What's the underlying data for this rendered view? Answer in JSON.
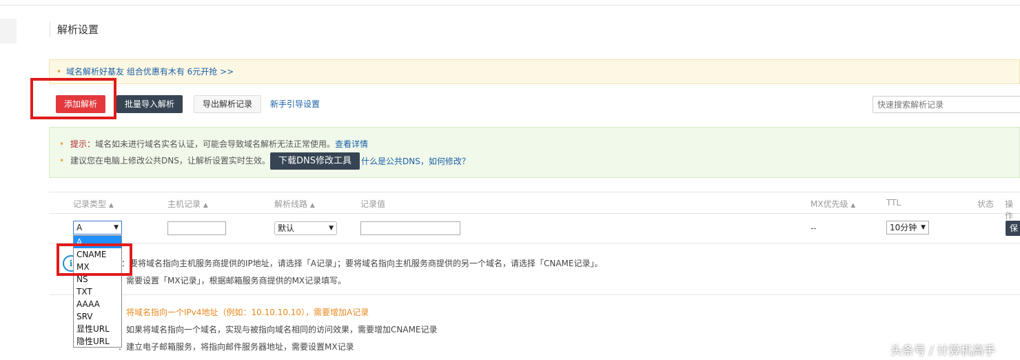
{
  "page_title": "解析设置",
  "promo": {
    "text": "域名解析好基友 组合优惠有木有 6元开抢 >>"
  },
  "toolbar": {
    "add": "添加解析",
    "batch_import": "批量导入解析",
    "export": "导出解析记录",
    "guide": "新手引导设置",
    "search_placeholder": "快速搜索解析记录"
  },
  "tips": {
    "label": "提示：",
    "line1": "域名如未进行域名实名认证，可能会导致域名解析无法正常使用。",
    "line1_link": "查看详情",
    "line2": "建议您在电脑上修改公共DNS，让解析设置实时生效。",
    "download_btn": "下载DNS修改工具",
    "line2_link": "什么是公共DNS，如何修改？"
  },
  "table": {
    "headers": {
      "type": "记录类型",
      "host": "主机记录",
      "line": "解析线路",
      "value": "记录值",
      "mx": "MX优先级",
      "ttl": "TTL",
      "status": "状态",
      "op": "操作"
    },
    "row": {
      "type": "A",
      "line": "默认",
      "mx": "--",
      "ttl": "10分钟",
      "save": "保"
    }
  },
  "type_options": [
    "A",
    "CNAME",
    "MX",
    "NS",
    "TXT",
    "AAAA",
    "SRV",
    "显性URL",
    "隐性URL"
  ],
  "info": {
    "line1": "：要将域名指向主机服务商提供的IP地址，请选择「A记录」；要将域名指向主机服务商提供的另一个域名，请选择「CNAME记录」。",
    "line2": "：需要设置「MX记录」，根据邮箱服务商提供的MX记录填写。"
  },
  "types_help": [
    "：将域名指向一个IPv4地址（例如：10.10.10.10），需要增加A记录",
    "：如果将域名指向一个域名，实现与被指向域名相同的访问效果，需要增加CNAME记录",
    "：建立电子邮箱服务，将指向邮件服务器地址，需要设置MX记录"
  ],
  "watermark": "头条号 / 计算机高手"
}
